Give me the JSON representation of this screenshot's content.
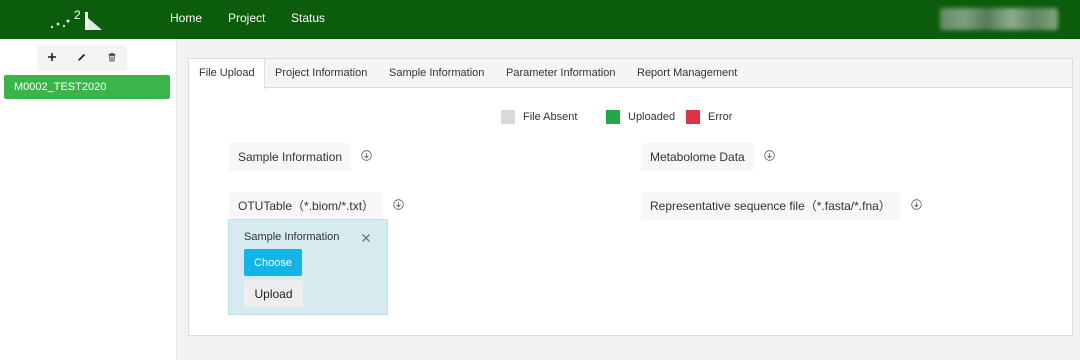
{
  "topbar": {
    "logo_text": "2",
    "nav": [
      "Home",
      "Project",
      "Status"
    ]
  },
  "sidebar": {
    "toolbar": [
      {
        "name": "add-icon",
        "glyph": "+"
      },
      {
        "name": "edit-icon",
        "glyph": "pencil"
      },
      {
        "name": "delete-icon",
        "glyph": "trash"
      }
    ],
    "projects": [
      "M0002_TEST2020"
    ]
  },
  "tabs": [
    "File Upload",
    "Project Information",
    "Sample Information",
    "Parameter Information",
    "Report Management"
  ],
  "active_tab": "File Upload",
  "legend": [
    {
      "label": "File Absent",
      "color": "#d9d9d9"
    },
    {
      "label": "Uploaded",
      "color": "#22a846"
    },
    {
      "label": "Error",
      "color": "#dc3545"
    }
  ],
  "files": {
    "sample_information": "Sample Information",
    "metabolome_data": "Metabolome Data",
    "otu_table": "OTUTable（*.biom/*.txt）",
    "representative_sequence": "Representative sequence file（*.fasta/*.fna）"
  },
  "popover": {
    "title": "Sample Information",
    "choose_label": "Choose",
    "upload_label": "Upload"
  },
  "colors": {
    "header": "#0b5d0b",
    "accent_green": "#3bb54a",
    "choose_blue": "#12b5e6",
    "popover_bg": "#d5ebf0"
  }
}
